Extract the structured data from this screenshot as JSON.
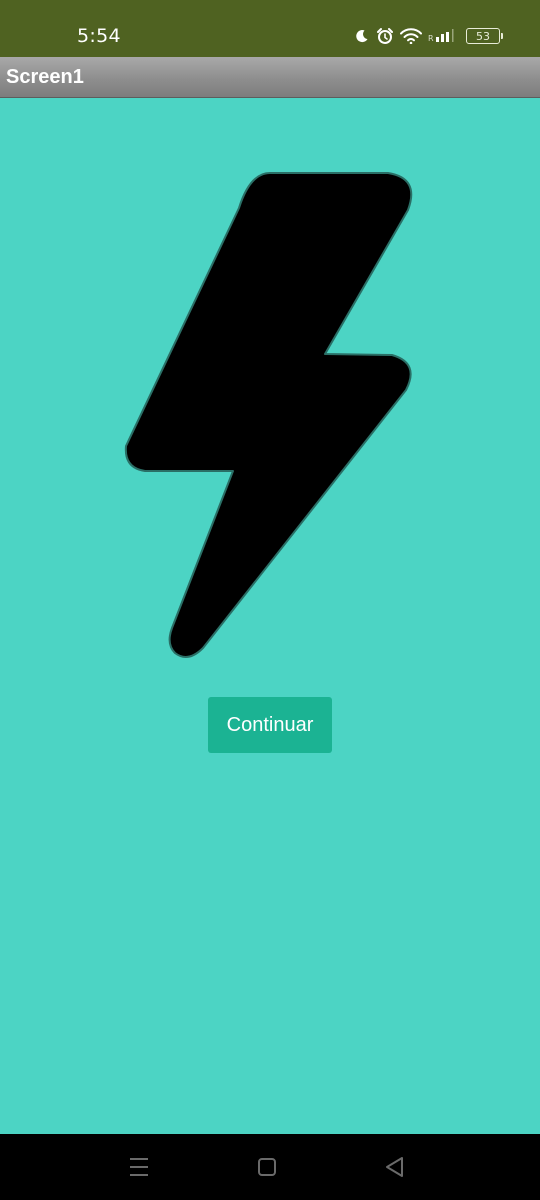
{
  "status_bar": {
    "time": "5:54",
    "battery_level": "53",
    "icons": [
      "moon-icon",
      "alarm-icon",
      "wifi-icon",
      "signal-icon",
      "battery-icon"
    ],
    "background_color": "#4f6221"
  },
  "title_bar": {
    "title": "Screen1"
  },
  "main": {
    "background_color": "#4cd4c4",
    "image_icon": "lightning-bolt-icon",
    "button_label": "Continuar",
    "button_color": "#1bb393"
  },
  "nav_bar": {
    "buttons": [
      "menu-icon",
      "home-icon",
      "back-icon"
    ]
  }
}
